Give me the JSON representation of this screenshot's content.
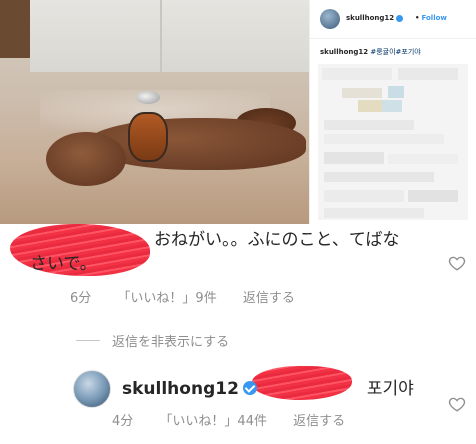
{
  "post": {
    "username": "skullhong12",
    "follow_label": "Follow",
    "separator": "•",
    "caption_user": "skullhong12",
    "caption_tags": "#룽귤이#포기야"
  },
  "comment": {
    "text_line1_visible": "おねがい。。ふにのこと、てばな",
    "text_line2": "さいで。",
    "time": "6分",
    "likes": "「いいね！」9件",
    "reply": "返信する"
  },
  "hide_replies": {
    "label": "返信を非表示にする"
  },
  "reply_comment": {
    "username": "skullhong12",
    "text_after_redaction": "포기야",
    "time": "4分",
    "likes": "「いいね！」44件",
    "reply": "返信する"
  },
  "colors": {
    "accent_blue": "#3897f0",
    "redaction_red": "#ee2a3c",
    "meta_gray": "#8e8e8e"
  },
  "icons": {
    "heart": "heart-outline-icon",
    "verified": "verified-badge-icon"
  }
}
